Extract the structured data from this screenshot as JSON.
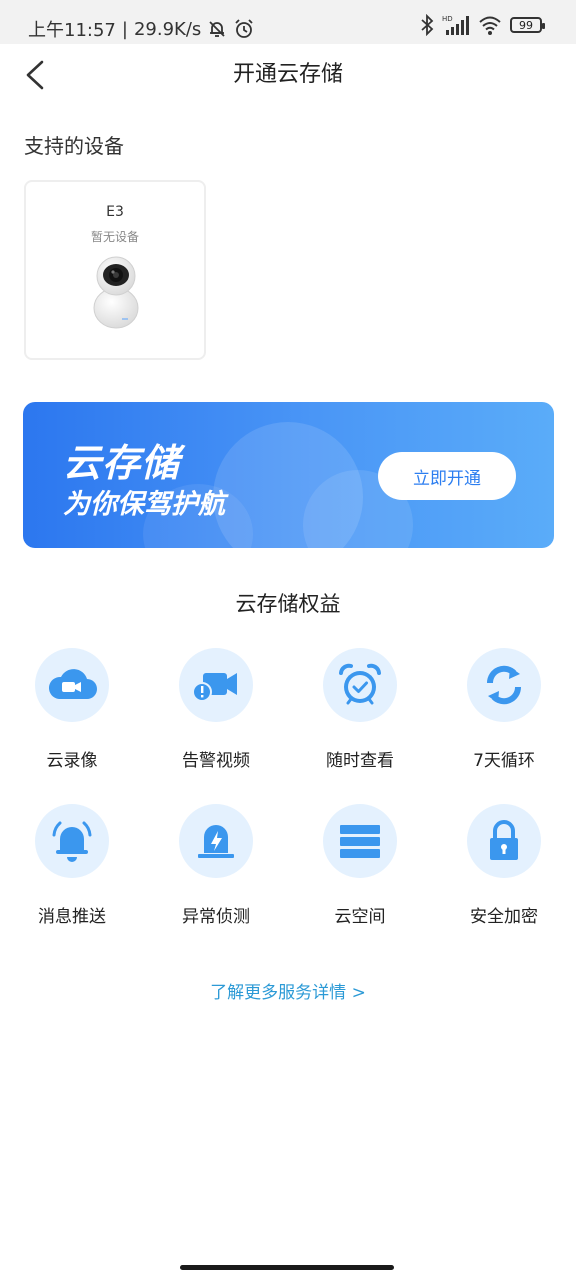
{
  "status_bar": {
    "time": "上午11:57",
    "separator": "|",
    "speed": "29.9K/s",
    "icons": [
      "bell-muted-icon",
      "alarm-icon",
      "bluetooth-icon",
      "hd-signal-icon",
      "wifi-icon"
    ],
    "battery": "99"
  },
  "header": {
    "title": "开通云存储"
  },
  "devices": {
    "section_label": "支持的设备",
    "items": [
      {
        "name": "E3",
        "status": "暂无设备"
      }
    ]
  },
  "banner": {
    "title": "云存储",
    "subtitle": "为你保驾护航",
    "button": "立即开通"
  },
  "benefits": {
    "title": "云存储权益",
    "items": [
      {
        "label": "云录像",
        "icon": "cloud-video-icon"
      },
      {
        "label": "告警视频",
        "icon": "alert-video-icon"
      },
      {
        "label": "随时查看",
        "icon": "alarm-clock-icon"
      },
      {
        "label": "7天循环",
        "icon": "cycle-icon"
      },
      {
        "label": "消息推送",
        "icon": "bell-icon"
      },
      {
        "label": "异常侦测",
        "icon": "siren-icon"
      },
      {
        "label": "云空间",
        "icon": "storage-icon"
      },
      {
        "label": "安全加密",
        "icon": "lock-icon"
      }
    ]
  },
  "more_link": "了解更多服务详情 >",
  "colors": {
    "primary": "#2c7ef0",
    "icon_bg": "#e4f1fe",
    "icon_fg": "#3b97ee",
    "link": "#2c9ad6"
  }
}
